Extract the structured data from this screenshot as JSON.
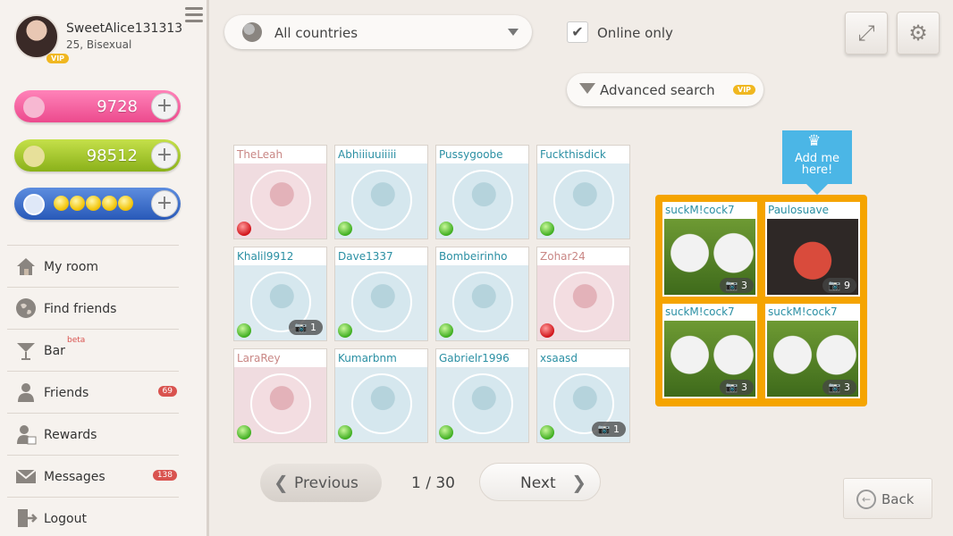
{
  "profile": {
    "username": "SweetAlice131313",
    "info": "25, Bisexual",
    "vip": "VIP"
  },
  "currencies": {
    "hearts": "9728",
    "coins": "98512",
    "plus": "+"
  },
  "nav": [
    {
      "label": "My room",
      "count": "",
      "extra": ""
    },
    {
      "label": "Find friends",
      "count": "",
      "extra": ""
    },
    {
      "label": "Bar",
      "count": "",
      "extra": "beta"
    },
    {
      "label": "Friends",
      "count": "69",
      "extra": ""
    },
    {
      "label": "Rewards",
      "count": "",
      "extra": ""
    },
    {
      "label": "Messages",
      "count": "138",
      "extra": ""
    },
    {
      "label": "Logout",
      "count": "",
      "extra": ""
    }
  ],
  "filters": {
    "country": "All countries",
    "online_only_label": "Online only",
    "online_only_checked": true,
    "advanced_label": "Advanced search",
    "advanced_vip": "VIP"
  },
  "users": [
    {
      "name": "TheLeah",
      "gender": "f",
      "online": false,
      "photos": ""
    },
    {
      "name": "Abhiiiuuiiiii",
      "gender": "m",
      "online": true,
      "photos": ""
    },
    {
      "name": "Pussygoobe",
      "gender": "m",
      "online": true,
      "photos": ""
    },
    {
      "name": "Fuckthisdick",
      "gender": "m",
      "online": true,
      "photos": ""
    },
    {
      "name": "Khalil9912",
      "gender": "m",
      "online": true,
      "photos": "1"
    },
    {
      "name": "Dave1337",
      "gender": "m",
      "online": true,
      "photos": ""
    },
    {
      "name": "Bombeirinho",
      "gender": "m",
      "online": true,
      "photos": ""
    },
    {
      "name": "Zohar24",
      "gender": "f",
      "online": false,
      "photos": ""
    },
    {
      "name": "LaraRey",
      "gender": "f",
      "online": true,
      "photos": ""
    },
    {
      "name": "Kumarbnm",
      "gender": "m",
      "online": true,
      "photos": ""
    },
    {
      "name": "Gabrielr1996",
      "gender": "m",
      "online": true,
      "photos": ""
    },
    {
      "name": "xsaasd",
      "gender": "m",
      "online": true,
      "photos": "1"
    }
  ],
  "featured": {
    "add_me": "Add me here!",
    "users": [
      {
        "name": "suckM!cock7",
        "photos": "3",
        "img": "skull"
      },
      {
        "name": "Paulosuave",
        "photos": "9",
        "img": "mask"
      },
      {
        "name": "suckM!cock7",
        "photos": "3",
        "img": "skull"
      },
      {
        "name": "suckM!cock7",
        "photos": "3",
        "img": "skull"
      }
    ]
  },
  "pagination": {
    "prev": "Previous",
    "next": "Next",
    "current": "1 / 30"
  },
  "back_label": "Back"
}
